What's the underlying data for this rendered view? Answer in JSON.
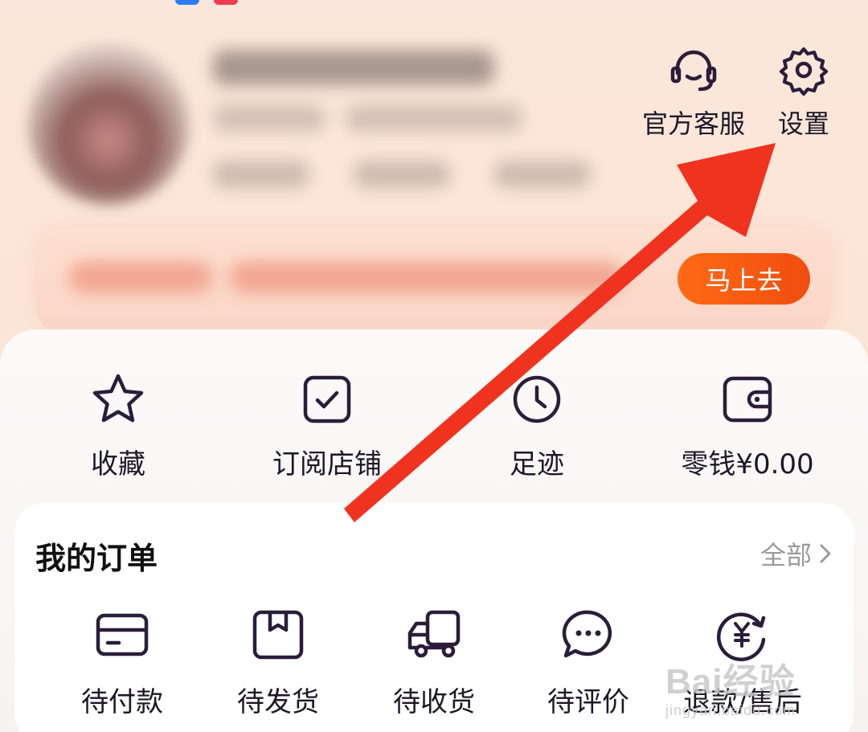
{
  "header": {
    "actions": [
      {
        "id": "customer-service",
        "label": "官方客服",
        "icon": "headset-icon"
      },
      {
        "id": "settings",
        "label": "设置",
        "icon": "gear-icon"
      }
    ]
  },
  "promo": {
    "button_label": "马上去"
  },
  "quick_links": [
    {
      "label": "收藏",
      "icon": "star-icon"
    },
    {
      "label": "订阅店铺",
      "icon": "checkbox-icon"
    },
    {
      "label": "足迹",
      "icon": "clock-icon"
    },
    {
      "label": "零钱¥0.00",
      "icon": "wallet-icon"
    }
  ],
  "orders": {
    "title": "我的订单",
    "all_label": "全部",
    "items": [
      {
        "label": "待付款",
        "icon": "card-icon"
      },
      {
        "label": "待发货",
        "icon": "package-icon"
      },
      {
        "label": "待收货",
        "icon": "truck-icon"
      },
      {
        "label": "待评价",
        "icon": "chat-bubble-icon"
      },
      {
        "label": "退款/售后",
        "icon": "refund-icon"
      }
    ]
  },
  "watermark": {
    "main": "Bai经验",
    "sub": "jingyan.baidu.com"
  },
  "colors": {
    "accent": "#f2581a",
    "arrow": "#f0331f",
    "icon_stroke": "#2b1d3a"
  }
}
